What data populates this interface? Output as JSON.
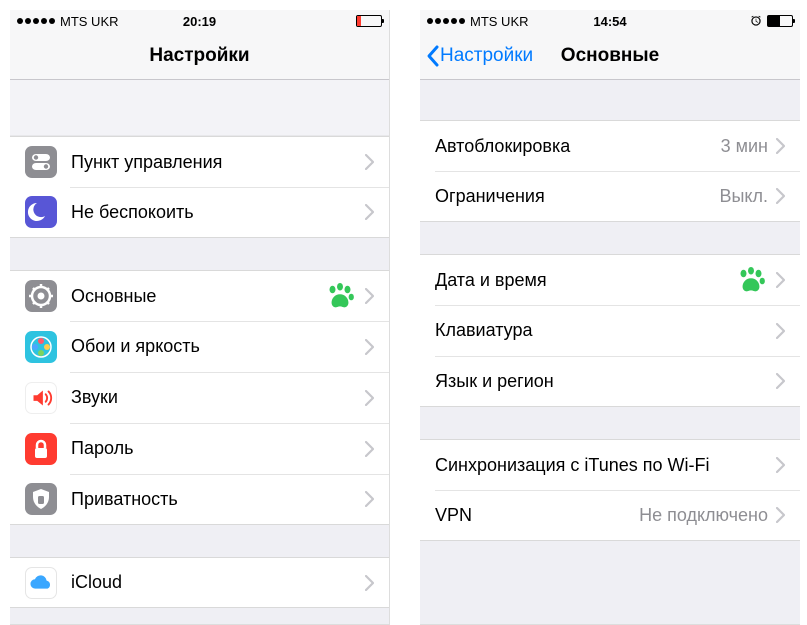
{
  "left": {
    "carrier": "MTS UKR",
    "time": "20:19",
    "title": "Настройки",
    "groups": [
      [
        {
          "icon": "control-center",
          "label": "Пункт управления"
        },
        {
          "icon": "dnd",
          "label": "Не беспокоить"
        }
      ],
      [
        {
          "icon": "general",
          "label": "Основные",
          "paw": true
        },
        {
          "icon": "wallpaper",
          "label": "Обои и яркость"
        },
        {
          "icon": "sounds",
          "label": "Звуки"
        },
        {
          "icon": "passcode",
          "label": "Пароль"
        },
        {
          "icon": "privacy",
          "label": "Приватность"
        }
      ],
      [
        {
          "icon": "icloud",
          "label": "iCloud"
        }
      ]
    ]
  },
  "right": {
    "carrier": "MTS UKR",
    "time": "14:54",
    "back": "Настройки",
    "title": "Основные",
    "groups": [
      [
        {
          "label": "Автоблокировка",
          "value": "3 мин"
        },
        {
          "label": "Ограничения",
          "value": "Выкл."
        }
      ],
      [
        {
          "label": "Дата и время",
          "paw": true
        },
        {
          "label": "Клавиатура"
        },
        {
          "label": "Язык и регион"
        }
      ],
      [
        {
          "label": "Синхронизация с iTunes по Wi-Fi"
        },
        {
          "label": "VPN",
          "value": "Не подключено"
        }
      ]
    ]
  },
  "iconColors": {
    "control-center": "#8e8e93",
    "dnd": "#5856d6",
    "general": "#8e8e93",
    "wallpaper": "#2ec3e0",
    "sounds": "#ff3b30",
    "passcode": "#ff3b30",
    "privacy": "#8e8e93",
    "icloud": "#ffffff"
  }
}
